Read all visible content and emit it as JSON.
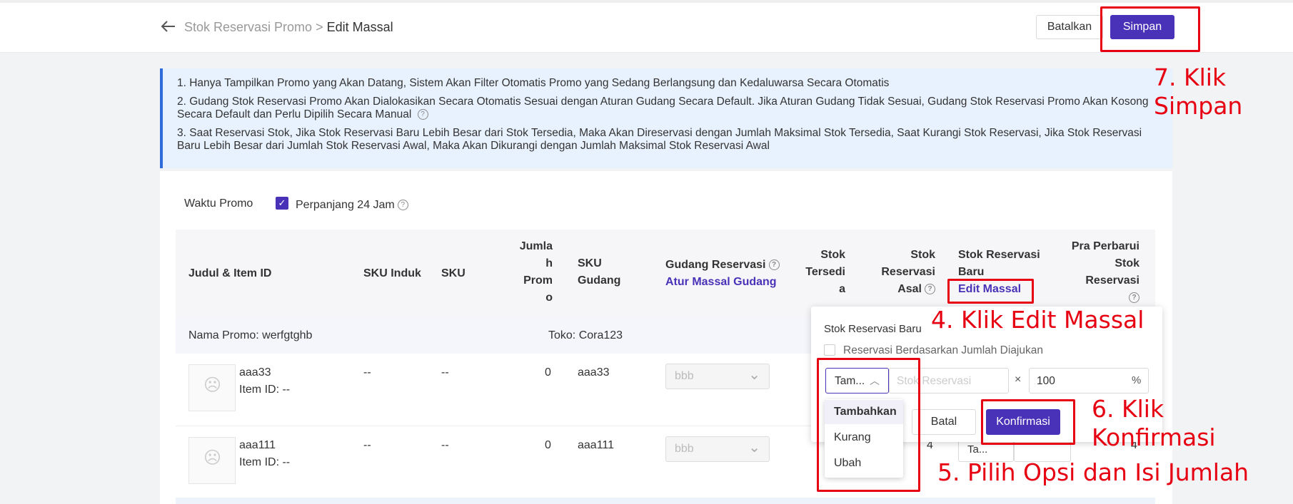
{
  "header": {
    "breadcrumb_parent": "Stok Reservasi Promo",
    "breadcrumb_sep": ">",
    "breadcrumb_current": "Edit Massal",
    "cancel_label": "Batalkan",
    "save_label": "Simpan"
  },
  "notice": {
    "lines": [
      "1. Hanya Tampilkan Promo yang Akan Datang, Sistem Akan Filter Otomatis Promo yang Sedang Berlangsung dan Kedaluwarsa Secara Otomatis",
      "2. Gudang Stok Reservasi Promo Akan Dialokasikan Secara Otomatis Sesuai dengan Aturan Gudang Secara Default. Jika Aturan Gudang Tidak Sesuai, Gudang Stok Reservasi Promo Akan Kosong Secara Default dan Perlu Dipilih Secara Manual",
      "3. Saat Reservasi Stok, Jika Stok Reservasi Baru Lebih Besar dari Stok Tersedia, Maka Akan Direservasi dengan Jumlah Maksimal Stok Tersedia, Saat Kurangi Stok Reservasi, Jika Stok Reservasi Baru Lebih Besar dari Jumlah Stok Reservasi Awal, Maka Akan Dikurangi dengan Jumlah Maksimal Stok Reservasi Awal"
    ]
  },
  "options": {
    "waktu_label": "Waktu Promo",
    "extend_label": "Perpanjang 24 Jam"
  },
  "table": {
    "headers": {
      "judul": "Judul & Item ID",
      "sku_induk": "SKU Induk",
      "sku": "SKU",
      "jumlah_promo": [
        "Jumla",
        "h",
        "Prom",
        "o"
      ],
      "sku_gudang": [
        "SKU",
        "Gudang"
      ],
      "gudang_reservasi": "Gudang Reservasi",
      "atur_massal": "Atur Massal Gudang",
      "stok_tersedia": [
        "Stok",
        "Tersedi",
        "a"
      ],
      "stok_reservasi_asal": [
        "Stok",
        "Reservasi",
        "Asal"
      ],
      "stok_reservasi_baru": [
        "Stok Reservasi",
        "Baru"
      ],
      "edit_massal": "Edit Massal",
      "pra_perbarui": [
        "Pra Perbarui",
        "Stok",
        "Reservasi"
      ]
    },
    "group": {
      "promo_name": "Nama Promo: werfgtghb",
      "shop": "Toko: Cora123"
    },
    "rows": [
      {
        "name": "aaa33",
        "item_id": "Item ID: --",
        "sku_induk": "--",
        "sku": "--",
        "jumlah": "0",
        "sku_gudang": "aaa33",
        "gudang": "bbb"
      },
      {
        "name": "aaa111",
        "item_id": "Item ID: --",
        "sku_induk": "--",
        "sku": "--",
        "jumlah": "0",
        "sku_gudang": "aaa111",
        "gudang": "bbb",
        "stok_asal": "4",
        "small_select": "Ta...",
        "pra": "4"
      }
    ]
  },
  "popup": {
    "title": "Stok Reservasi Baru",
    "checkbox_label": "Reservasi Berdasarkan Jumlah Diajukan",
    "dropdown_value": "Tam...",
    "stock_placeholder": "Stok Reservasi",
    "times": "×",
    "percent_value": "100",
    "percent_sign": "%",
    "menu": [
      "Tambahkan",
      "Kurang",
      "Ubah"
    ],
    "batal_label": "Batal",
    "konfirmasi_label": "Konfirmasi"
  },
  "annotations": {
    "step4": "4. Klik Edit Massal",
    "step5": "5. Pilih Opsi dan Isi Jumlah",
    "step6": "6. Klik Konfirmasi",
    "step7_line1": "7. Klik",
    "step7_line2": "Simpan",
    "color": "#e60012"
  },
  "colors": {
    "primary": "#4a32b8",
    "notice_bg": "#e8f2ff",
    "notice_border": "#2f6bd9"
  }
}
